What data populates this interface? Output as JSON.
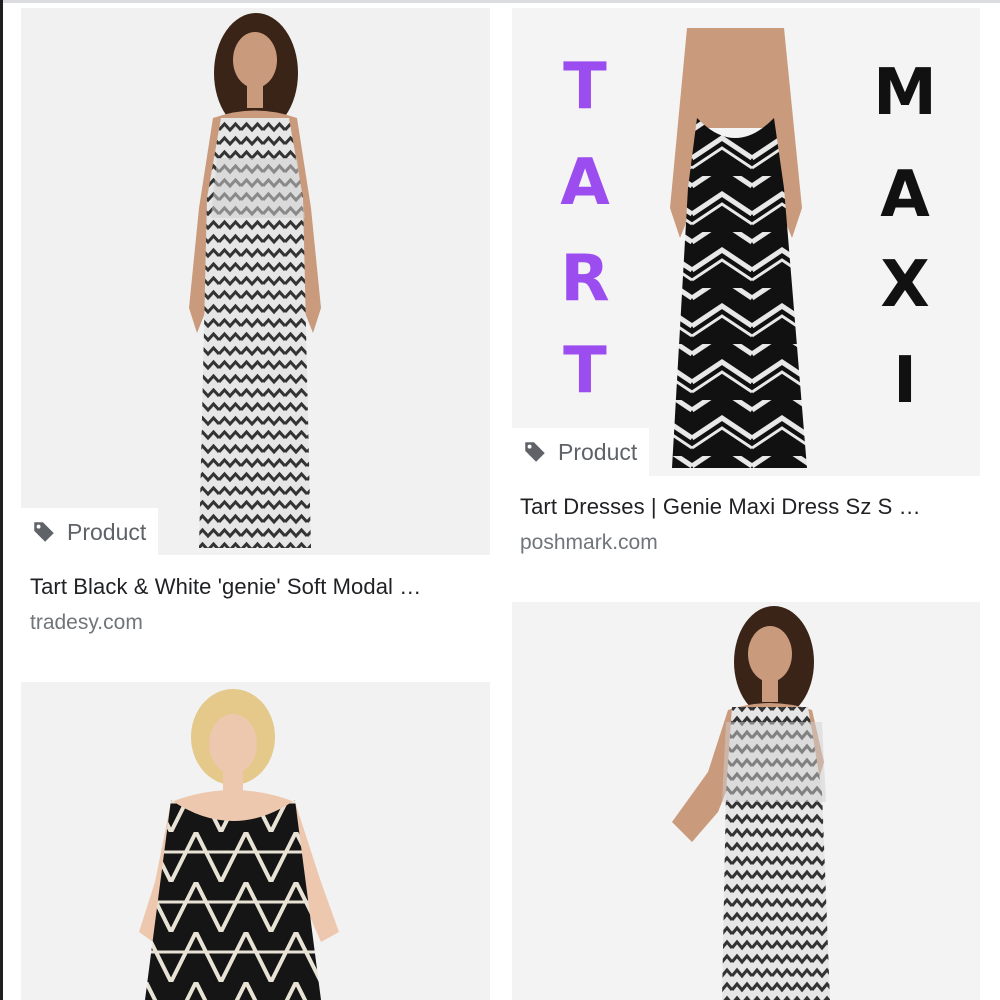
{
  "results": [
    {
      "badge": "Product",
      "title": "Tart Black & White 'genie' Soft Modal …",
      "source": "tradesy.com"
    },
    {
      "badge": "Product",
      "title": "Tart Dresses | Genie Maxi Dress Sz S …",
      "source": "poshmark.com",
      "overlay": {
        "left_letters": [
          "T",
          "A",
          "R",
          "T"
        ],
        "right_letters": [
          "M",
          "A",
          "X",
          "I"
        ],
        "left_color": "#9b4df0",
        "right_color": "#111111"
      }
    },
    {
      "badge": "",
      "title": "",
      "source": ""
    },
    {
      "badge": "",
      "title": "",
      "source": ""
    }
  ],
  "colors": {
    "thumb_bg": "#f1f1f1",
    "badge_text": "#5f6368",
    "source_text": "#70757a"
  },
  "icons": {
    "badge_icon": "tag-icon"
  }
}
